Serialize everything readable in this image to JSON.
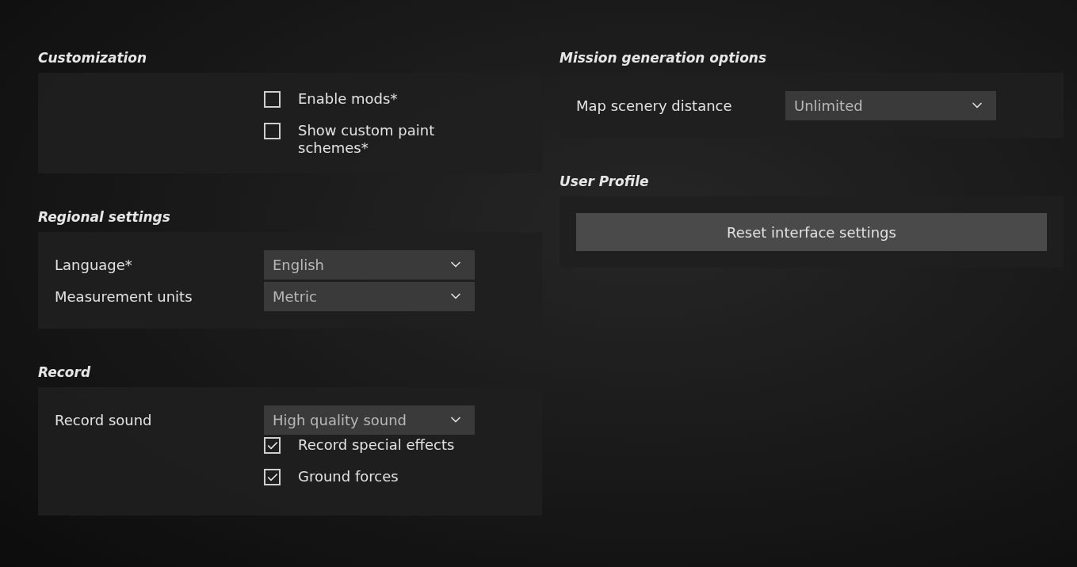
{
  "columns": [
    {
      "sections": [
        {
          "title": "Customization",
          "rows": [
            {
              "kind": "checkbox",
              "text": "Enable mods*",
              "checked": false
            },
            {
              "kind": "checkbox",
              "text": "Show custom paint schemes*",
              "checked": false
            }
          ]
        },
        {
          "title": "Regional settings",
          "rows": [
            {
              "kind": "select",
              "label": "Language*",
              "value": "English"
            },
            {
              "kind": "select",
              "label": "Measurement units",
              "value": "Metric"
            }
          ]
        },
        {
          "title": "Record",
          "rows": [
            {
              "kind": "select",
              "label": "Record sound",
              "value": "High quality sound"
            },
            {
              "kind": "checkbox",
              "text": "Record special effects",
              "checked": true
            },
            {
              "kind": "checkbox",
              "text": "Ground forces",
              "checked": true
            }
          ]
        }
      ]
    },
    {
      "sections": [
        {
          "title": "Mission generation options",
          "rows": [
            {
              "kind": "select",
              "label": "Map scenery distance",
              "value": "Unlimited"
            }
          ]
        },
        {
          "title": "User Profile",
          "rows": [
            {
              "kind": "button",
              "text": "Reset interface settings"
            }
          ]
        }
      ]
    }
  ]
}
